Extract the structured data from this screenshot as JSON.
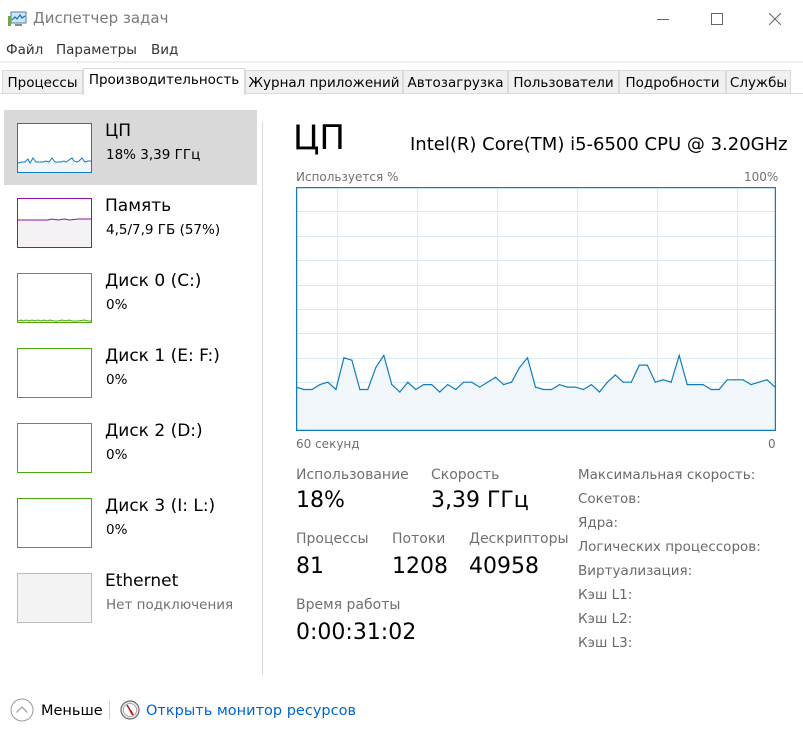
{
  "window": {
    "title": "Диспетчер задач",
    "minimize_icon": "minimize-icon",
    "maximize_icon": "maximize-icon",
    "close_icon": "close-icon"
  },
  "menu": [
    {
      "label": "Файл"
    },
    {
      "label": "Параметры"
    },
    {
      "label": "Вид"
    }
  ],
  "tabs": [
    {
      "label": "Процессы",
      "active": false
    },
    {
      "label": "Производительность",
      "active": true
    },
    {
      "label": "Журнал приложений",
      "active": false
    },
    {
      "label": "Автозагрузка",
      "active": false
    },
    {
      "label": "Пользователи",
      "active": false
    },
    {
      "label": "Подробности",
      "active": false
    },
    {
      "label": "Службы",
      "active": false
    }
  ],
  "sidebar": {
    "items": [
      {
        "title": "ЦП",
        "subtitle": "18%  3,39 ГГц",
        "color": "#117dbb",
        "fill": "#f1f6fa",
        "selected": true
      },
      {
        "title": "Память",
        "subtitle": "4,5/7,9 ГБ (57%)",
        "color": "#8b12ae",
        "fill": "#f4f2f4",
        "selected": false
      },
      {
        "title": "Диск 0 (C:)",
        "subtitle": "0%",
        "color": "#4da60c",
        "fill": "#ffffff",
        "selected": false
      },
      {
        "title": "Диск 1 (E: F:)",
        "subtitle": "0%",
        "color": "#4da60c",
        "fill": "#ffffff",
        "selected": false
      },
      {
        "title": "Диск 2 (D:)",
        "subtitle": "0%",
        "color": "#4da60c",
        "fill": "#ffffff",
        "selected": false
      },
      {
        "title": "Диск 3 (I: L:)",
        "subtitle": "0%",
        "color": "#4da60c",
        "fill": "#ffffff",
        "selected": false
      },
      {
        "title": "Ethernet",
        "subtitle": "Нет подключения",
        "color": "#bcbcbc",
        "fill": "#f3f3f3",
        "selected": false
      }
    ]
  },
  "main": {
    "title": "ЦП",
    "cpu_model": "Intel(R) Core(TM) i5-6500 CPU @ 3.20GHz",
    "stats": {
      "usage_label": "Использование",
      "usage_value": "18%",
      "speed_label": "Скорость",
      "speed_value": "3,39 ГГц",
      "processes_label": "Процессы",
      "processes_value": "81",
      "threads_label": "Потоки",
      "threads_value": "1208",
      "handles_label": "Дескрипторы",
      "handles_value": "40958",
      "uptime_label": "Время работы",
      "uptime_value": "0:00:31:02"
    },
    "specs": [
      {
        "label": "Максимальная скорость:"
      },
      {
        "label": "Сокетов:"
      },
      {
        "label": "Ядра:"
      },
      {
        "label": "Логических процессоров:"
      },
      {
        "label": "Виртуализация:"
      },
      {
        "label": "Кэш L1:"
      },
      {
        "label": "Кэш L2:"
      },
      {
        "label": "Кэш L3:"
      }
    ]
  },
  "chart_data": {
    "type": "area",
    "title": "Используется %",
    "ylabel": "Используется %",
    "y_max_label": "100%",
    "x_left_label": "60 секунд",
    "x_right_label": "0",
    "ylim": [
      0,
      100
    ],
    "xlim": [
      60,
      0
    ],
    "grid": true,
    "line_color": "#117dbb",
    "fill_color": "#f1f6fa",
    "grid_color": "#d9eaf4",
    "x": [
      60,
      59,
      58,
      57,
      56,
      55,
      54,
      53,
      52,
      51,
      50,
      49,
      48,
      47,
      46,
      45,
      44,
      43,
      42,
      41,
      40,
      39,
      38,
      37,
      36,
      35,
      34,
      33,
      32,
      31,
      30,
      29,
      28,
      27,
      26,
      25,
      24,
      23,
      22,
      21,
      20,
      19,
      18,
      17,
      16,
      15,
      14,
      13,
      12,
      11,
      10,
      9,
      8,
      7,
      6,
      5,
      4,
      3,
      2,
      1,
      0
    ],
    "values": [
      18,
      17,
      17,
      19,
      20,
      17,
      30,
      29,
      17,
      17,
      26,
      31,
      19,
      16,
      20,
      17,
      19,
      19,
      16,
      19,
      17,
      20,
      20,
      18,
      20,
      22,
      19,
      20,
      26,
      30,
      18,
      17,
      17,
      19,
      18,
      18,
      17,
      19,
      16,
      20,
      23,
      20,
      20,
      27,
      27,
      20,
      21,
      20,
      31,
      19,
      19,
      19,
      17,
      17,
      21,
      21,
      21,
      19,
      20,
      21,
      18
    ]
  },
  "footer": {
    "less_label": "Меньше",
    "monitor_link": "Открыть монитор ресурсов"
  }
}
